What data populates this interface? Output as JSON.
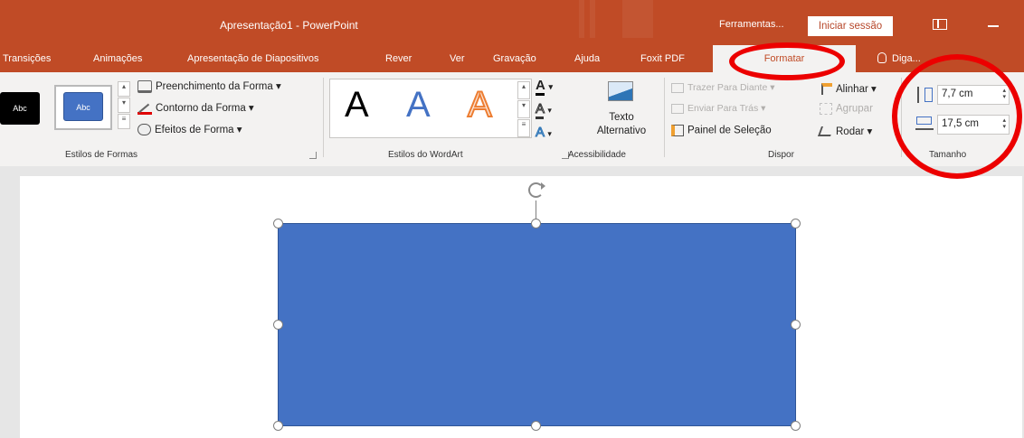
{
  "window": {
    "title": "Apresentação1  -  PowerPoint",
    "tools_label": "Ferramentas...",
    "sign_in": "Iniciar sessão"
  },
  "tabs": [
    {
      "label": "Transições"
    },
    {
      "label": "Animações"
    },
    {
      "label": "Apresentação de Diapositivos"
    },
    {
      "label": "Rever"
    },
    {
      "label": "Ver"
    },
    {
      "label": "Gravação"
    },
    {
      "label": "Ajuda"
    },
    {
      "label": "Foxit PDF"
    },
    {
      "label": "Formatar",
      "active": true
    }
  ],
  "tell_me": "Diga...",
  "ribbon": {
    "shape_styles": {
      "label": "Estilos de Formas",
      "swatch_text": "Abc",
      "fill": "Preenchimento da Forma",
      "outline": "Contorno da Forma",
      "effects": "Efeitos de Forma"
    },
    "wordart": {
      "label": "Estilos do WordArt",
      "letter": "A"
    },
    "accessibility": {
      "label": "Acessibilidade",
      "alt_text_line1": "Texto",
      "alt_text_line2": "Alternativo"
    },
    "arrange": {
      "label": "Dispor",
      "bring_forward": "Trazer Para Diante",
      "send_backward": "Enviar Para Trás",
      "selection_pane": "Painel de Seleção",
      "align": "Alinhar",
      "group": "Agrupar",
      "rotate": "Rodar"
    },
    "size": {
      "label": "Tamanho",
      "height": "7,7 cm",
      "width": "17,5 cm"
    }
  },
  "colors": {
    "accent": "#c04b26",
    "shape_fill": "#4472c4",
    "annotation": "#ec0000"
  }
}
